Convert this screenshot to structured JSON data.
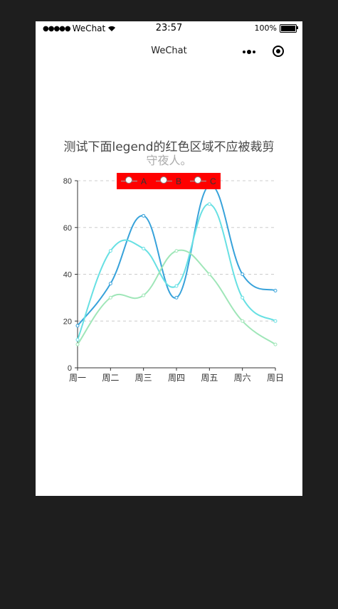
{
  "status_bar": {
    "carrier": "WeChat",
    "time": "23:57",
    "battery": "100%"
  },
  "nav": {
    "title": "WeChat"
  },
  "chart_data": {
    "type": "line",
    "title": "测试下面legend的红色区域不应被裁剪",
    "subtitle": "守夜人。",
    "categories": [
      "周一",
      "周二",
      "周三",
      "周四",
      "周五",
      "周六",
      "周日"
    ],
    "series": [
      {
        "name": "A",
        "values": [
          18,
          36,
          65,
          30,
          78,
          40,
          33
        ],
        "color": "#37a2da"
      },
      {
        "name": "B",
        "values": [
          12,
          50,
          51,
          35,
          70,
          30,
          20
        ],
        "color": "#67e0e3"
      },
      {
        "name": "C",
        "values": [
          10,
          30,
          31,
          50,
          40,
          20,
          10
        ],
        "color": "#9fe6b8"
      }
    ],
    "ylim": [
      0,
      80
    ],
    "yticks": [
      "0",
      "20",
      "40",
      "60",
      "80"
    ],
    "smooth": true,
    "grid": true,
    "legend": {
      "position": "top",
      "background": "#ff0000"
    }
  }
}
